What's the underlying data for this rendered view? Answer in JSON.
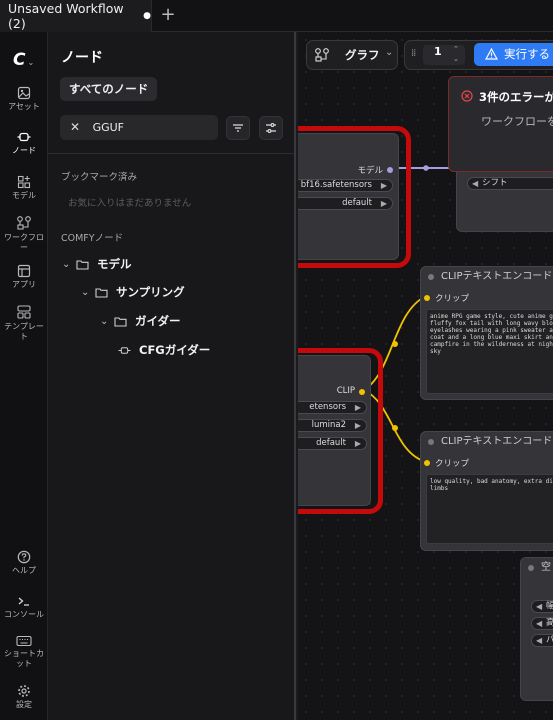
{
  "tabs": [
    {
      "label": "Unsaved Workflow (2)",
      "modified_marker": "●"
    }
  ],
  "new_tab_label": "+",
  "rail": {
    "logo": "C",
    "items": [
      {
        "label": "アセット",
        "icon": "image-icon"
      },
      {
        "label": "ノード",
        "icon": "node-icon",
        "active": true
      },
      {
        "label": "モデル",
        "icon": "model-icon"
      },
      {
        "label": "ワークフロー",
        "icon": "workflow-icon"
      },
      {
        "label": "アプリ",
        "icon": "app-icon"
      },
      {
        "label": "テンプレート",
        "icon": "template-icon"
      },
      {
        "label": "ヘルプ",
        "icon": "help-icon"
      },
      {
        "label": "コンソール",
        "icon": "console-icon"
      },
      {
        "label": "ショートカット",
        "icon": "keyboard-icon"
      },
      {
        "label": "設定",
        "icon": "gear-icon"
      }
    ]
  },
  "panel": {
    "title": "ノード",
    "all_nodes_button": "すべてのノード",
    "search_value": "GGUF",
    "bookmarks_header": "ブックマーク済み",
    "bookmarks_empty": "お気に入りはまだありません",
    "comfy_header": "COMFYノード",
    "tree": [
      {
        "label": "モデル",
        "level": 0,
        "type": "folder"
      },
      {
        "label": "サンプリング",
        "level": 1,
        "type": "folder"
      },
      {
        "label": "ガイダー",
        "level": 2,
        "type": "folder"
      },
      {
        "label": "CFGガイダー",
        "level": 3,
        "type": "node"
      }
    ]
  },
  "canvas": {
    "graph_button": "グラフ",
    "queue_count": "1",
    "run_button": "実行する",
    "error_title": "3件のエラーが",
    "error_sub": "ワークフローを",
    "shift_widget": "シフト",
    "node1": {
      "output_label": "モデル",
      "widgets": [
        "bf16.safetensors",
        "default"
      ]
    },
    "node2": {
      "output_label": "CLIP",
      "widgets": [
        "etensors",
        "lumina2",
        "default"
      ]
    },
    "clip1": {
      "title": "CLIPテキストエンコード",
      "input_label": "クリップ",
      "text": "anime RPG game style, cute anime gi\nfluffy fox tail with long wavy blon\neyelashes wearing a pink sweater a\ncoat and a long blue maxi skirt and\ncampfire in the wilderness at night\nsky"
    },
    "clip2": {
      "title": "CLIPテキストエンコード",
      "input_label": "クリップ",
      "text": "low quality, bad anatomy, extra dig\nlimbs"
    },
    "node5": {
      "title": "空",
      "widgets": [
        "幅",
        "高",
        "パ"
      ]
    }
  }
}
